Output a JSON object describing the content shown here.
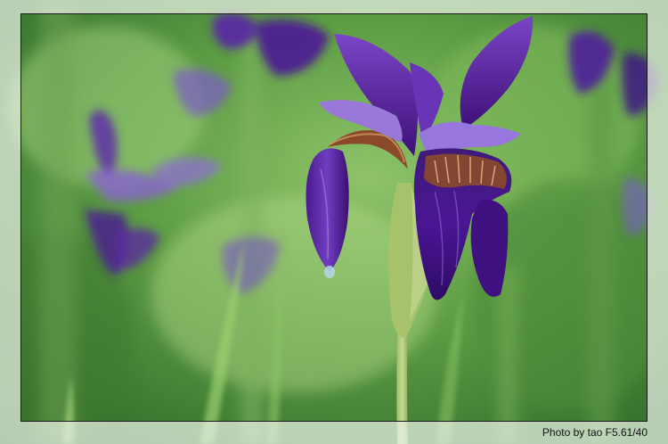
{
  "photo": {
    "subject": "purple-iris-flower",
    "credit": "Photo by tao F5.61/40"
  },
  "colors": {
    "petal": "#5a1fa0",
    "petal_light": "#8d5fd0",
    "foliage": "#5e9e45",
    "frame_mat": "#eef3ea"
  }
}
